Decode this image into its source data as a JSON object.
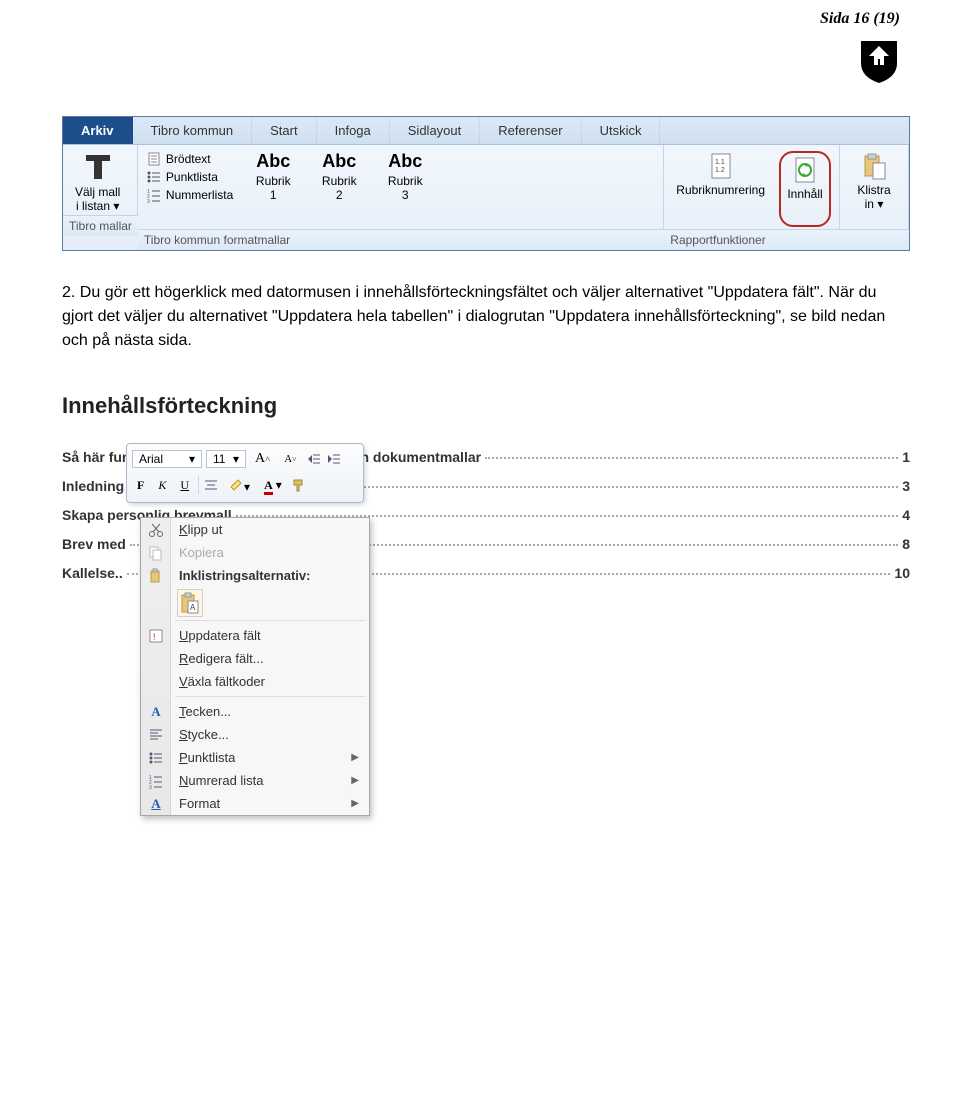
{
  "page_header": "Sida 16 (19)",
  "ribbon": {
    "tabs": [
      "Arkiv",
      "Tibro kommun",
      "Start",
      "Infoga",
      "Sidlayout",
      "Referenser",
      "Utskick"
    ],
    "group_labels": [
      "Tibro mallar",
      "Tibro kommun formatmallar",
      "Rapportfunktioner"
    ],
    "valj_mall": "Välj mall i listan",
    "body_list": [
      "Brödtext",
      "Punktlista",
      "Nummerlista"
    ],
    "rubrik_prefix": "Rubrik",
    "rubrik1": "1",
    "rubrik2": "2",
    "rubrik3": "3",
    "rubriknum": "Rubriknumrering",
    "innhall": "Innhåll",
    "klistra": "Klistra in"
  },
  "paragraph": "2. Du gör ett högerklick med datormusen i innehållsförteckningsfältet och väljer alternativet \"Uppdatera fält\". När du gjort det väljer du  alternativet \"Uppdatera hela tabellen\" i dialogrutan \"Uppdatera innehållsförteckning\", se bild nedan och på nästa sida.",
  "toc": {
    "title": "Innehållsförteckning",
    "lines": [
      {
        "text": "Så här fungerar Tibro kommuns nya brev- och dokumentmallar",
        "page": "1"
      },
      {
        "text": "Inledning",
        "page": "3"
      },
      {
        "text": "Skapa personlig brevmall",
        "page": "4"
      },
      {
        "text": "Brev med",
        "page": "8"
      },
      {
        "text": "Kallelse..",
        "page": "10"
      }
    ]
  },
  "mini_toolbar": {
    "font": "Arial",
    "size": "11"
  },
  "context_menu": [
    {
      "icon": "cut",
      "label": "Klipp ut",
      "underline": true,
      "disabled": false
    },
    {
      "icon": "copy",
      "label": "Kopiera",
      "underline": false,
      "disabled": true
    },
    {
      "icon": "paste-opts",
      "label": "Inklistringsalternativ:",
      "underline": false,
      "sub": "paste-big"
    },
    {
      "sep": true
    },
    {
      "icon": "update",
      "label": "Uppdatera fält",
      "ul_first": true
    },
    {
      "icon": "",
      "label": "Redigera fält...",
      "ul_first": true
    },
    {
      "icon": "",
      "label": "Växla fältkoder"
    },
    {
      "sep": true
    },
    {
      "icon": "font",
      "label": "Tecken...",
      "ul_first": true
    },
    {
      "icon": "para",
      "label": "Stycke...",
      "ul_first": true
    },
    {
      "icon": "bullets",
      "label": "Punktlista",
      "arrow": true
    },
    {
      "icon": "numbers",
      "label": "Numrerad lista",
      "ul_first": true,
      "arrow": true
    },
    {
      "icon": "styles",
      "label": "Format",
      "arrow": true
    }
  ]
}
